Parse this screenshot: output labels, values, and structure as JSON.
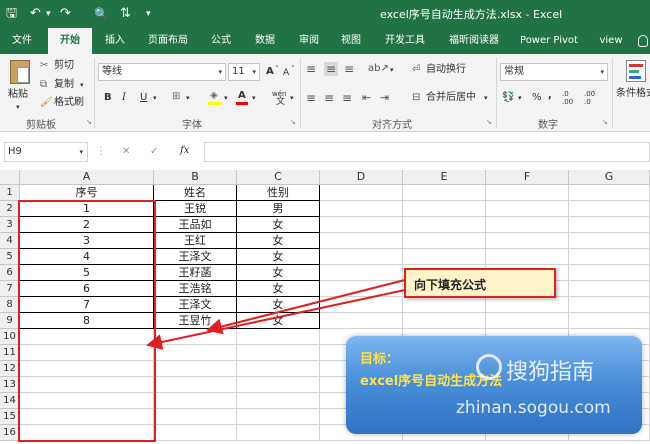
{
  "window": {
    "title": "excel序号自动生成方法.xlsx  -  Excel"
  },
  "quick_access": {
    "save": "🖫",
    "undo": "↶",
    "undo_arrow": "▾",
    "redo": "↷",
    "preview": "🔍",
    "sort": "⇅",
    "customize": "▾"
  },
  "tabs": [
    "文件",
    "开始",
    "插入",
    "页面布局",
    "公式",
    "数据",
    "审阅",
    "视图",
    "开发工具",
    "福昕阅读器",
    "Power Pivot",
    "view"
  ],
  "tell_me_icon": "lightbulb-icon",
  "ribbon": {
    "clipboard": {
      "paste": "粘贴",
      "cut": "剪切",
      "copy": "复制",
      "format_painter": "格式刷",
      "label": "剪贴板"
    },
    "font": {
      "name": "等线",
      "size": "11",
      "grow": "A",
      "shrink": "A",
      "bold": "B",
      "italic": "I",
      "underline": "U",
      "border": "⊞",
      "fill": "A",
      "color": "A",
      "phonetic": "wén",
      "label": "字体"
    },
    "alignment": {
      "wrap": "自动换行",
      "merge": "合并后居中",
      "label": "对齐方式"
    },
    "number": {
      "format": "常规",
      "percent": "%",
      "comma": ",",
      "inc": ".0 .00",
      "dec": ".00 .0",
      "label": "数字"
    },
    "styles": {
      "conditional": "条件格式"
    },
    "accent_color": "#217346",
    "font_color_bar": "#ff0000",
    "fill_color_bar": "#ffff00"
  },
  "formula_bar": {
    "name_box": "H9",
    "cancel": "✕",
    "enter": "✓",
    "fx": "fx",
    "value": ""
  },
  "sheet": {
    "columns": [
      "A",
      "B",
      "C",
      "D",
      "E",
      "F",
      "G"
    ],
    "rows": [
      "1",
      "2",
      "3",
      "4",
      "5",
      "6",
      "7",
      "8",
      "9",
      "10",
      "11",
      "12",
      "13",
      "14",
      "15",
      "16"
    ],
    "data": [
      [
        "序号",
        "姓名",
        "性别"
      ],
      [
        "1",
        "王锐",
        "男"
      ],
      [
        "2",
        "王品如",
        "女"
      ],
      [
        "3",
        "王红",
        "女"
      ],
      [
        "4",
        "王泽文",
        "女"
      ],
      [
        "5",
        "王籽菡",
        "女"
      ],
      [
        "6",
        "王浩铭",
        "女"
      ],
      [
        "7",
        "王泽文",
        "女"
      ],
      [
        "8",
        "王昱竹",
        "女"
      ]
    ]
  },
  "callout": {
    "text": "向下填充公式",
    "bg": "#fff4c7",
    "border": "#ff0000"
  },
  "banner": {
    "line1": "目标：",
    "line2": "excel序号自动生成方法",
    "bg": "#4a8fd8",
    "text_color": "#ffe14a"
  },
  "watermark": {
    "brand": "搜狗指南",
    "url": "zhinan.sogou.com"
  },
  "annotation_color": "#e02020"
}
